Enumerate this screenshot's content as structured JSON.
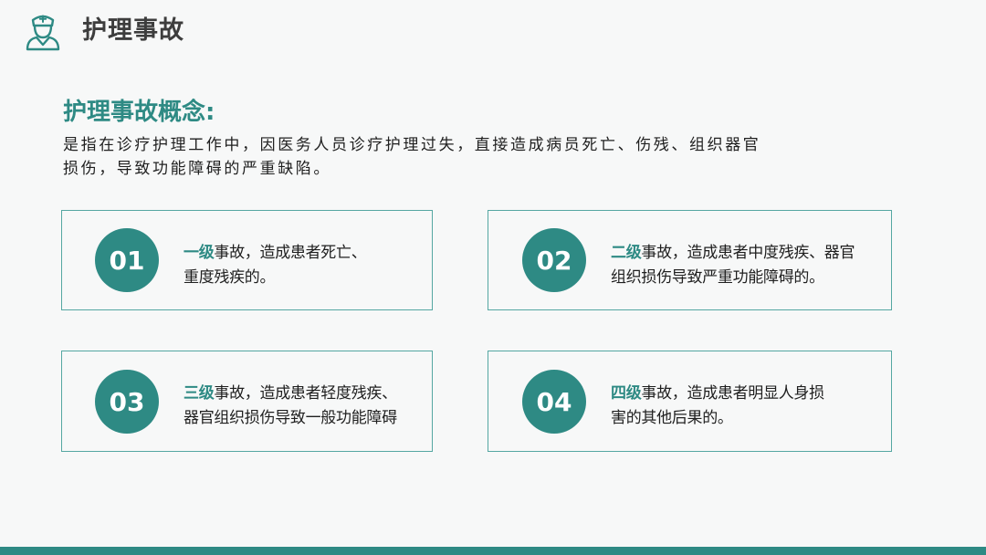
{
  "header": {
    "title": "护理事故",
    "icon": "nurse-icon"
  },
  "concept": {
    "heading": "护理事故概念:",
    "body_line1": "是指在诊疗护理工作中，因医务人员诊疗护理过失，直接造成病员死亡、伤残、组织器官",
    "body_line2": "损伤，导致功能障碍的严重缺陷。"
  },
  "cards": [
    {
      "number": "01",
      "level": "一级",
      "line1": "事故，造成患者死亡、",
      "line2": "重度残疾的。"
    },
    {
      "number": "02",
      "level": "二级",
      "line1": "事故，造成患者中度残疾、器官",
      "line2": "组织损伤导致严重功能障碍的。"
    },
    {
      "number": "03",
      "level": "三级",
      "line1": "事故，造成患者轻度残疾、",
      "line2": "器官组织损伤导致一般功能障碍"
    },
    {
      "number": "04",
      "level": "四级",
      "line1": "事故，造成患者明显人身损",
      "line2": "害的其他后果的。"
    }
  ],
  "colors": {
    "accent": "#2e8a84",
    "background": "#f7f8f8",
    "card_border": "#55a7a2"
  }
}
